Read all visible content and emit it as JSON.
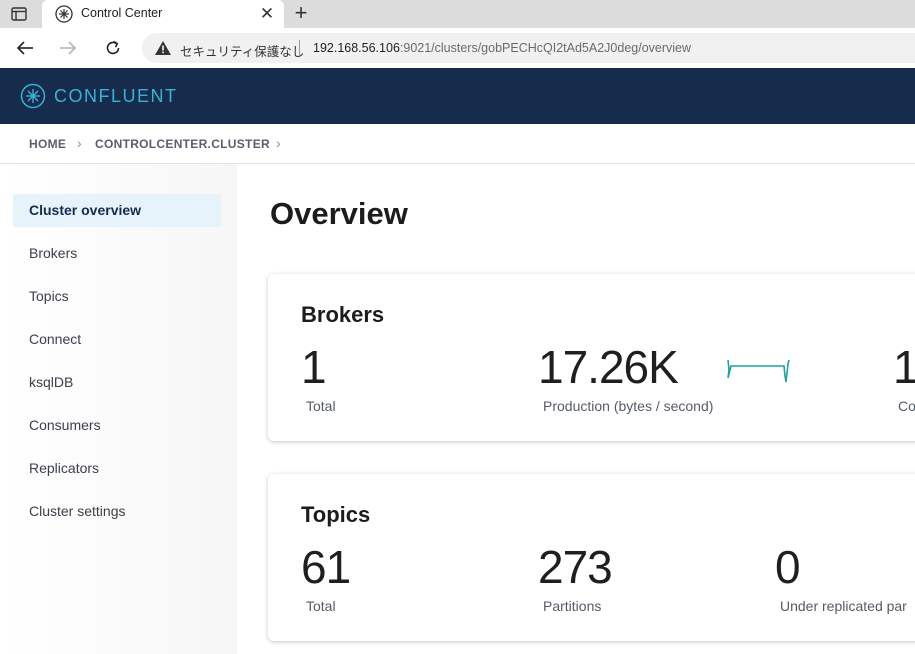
{
  "browser": {
    "tab_title": "Control Center",
    "insecure_label": "セキュリティ保護なし",
    "url_host": "192.168.56.106",
    "url_rest": ":9021/clusters/gobPECHcQI2tAd5A2J0deg/overview"
  },
  "header": {
    "brand": "CONFLUENT",
    "brand_color": "#38b2d4",
    "background": "#172b4d"
  },
  "breadcrumb": {
    "items": [
      "HOME",
      "CONTROLCENTER.CLUSTER"
    ]
  },
  "sidebar": {
    "items": [
      {
        "label": "Cluster overview",
        "active": true
      },
      {
        "label": "Brokers"
      },
      {
        "label": "Topics"
      },
      {
        "label": "Connect"
      },
      {
        "label": "ksqlDB"
      },
      {
        "label": "Consumers"
      },
      {
        "label": "Replicators"
      },
      {
        "label": "Cluster settings"
      }
    ]
  },
  "main": {
    "title": "Overview",
    "brokers_card": {
      "title": "Brokers",
      "total_value": "1",
      "total_label": "Total",
      "production_value": "17.26K",
      "production_label": "Production (bytes / second)",
      "third_value": "1",
      "third_label": "Co"
    },
    "topics_card": {
      "title": "Topics",
      "total_value": "61",
      "total_label": "Total",
      "partitions_value": "273",
      "partitions_label": "Partitions",
      "under_replicated_value": "0",
      "under_replicated_label": "Under replicated par"
    }
  }
}
